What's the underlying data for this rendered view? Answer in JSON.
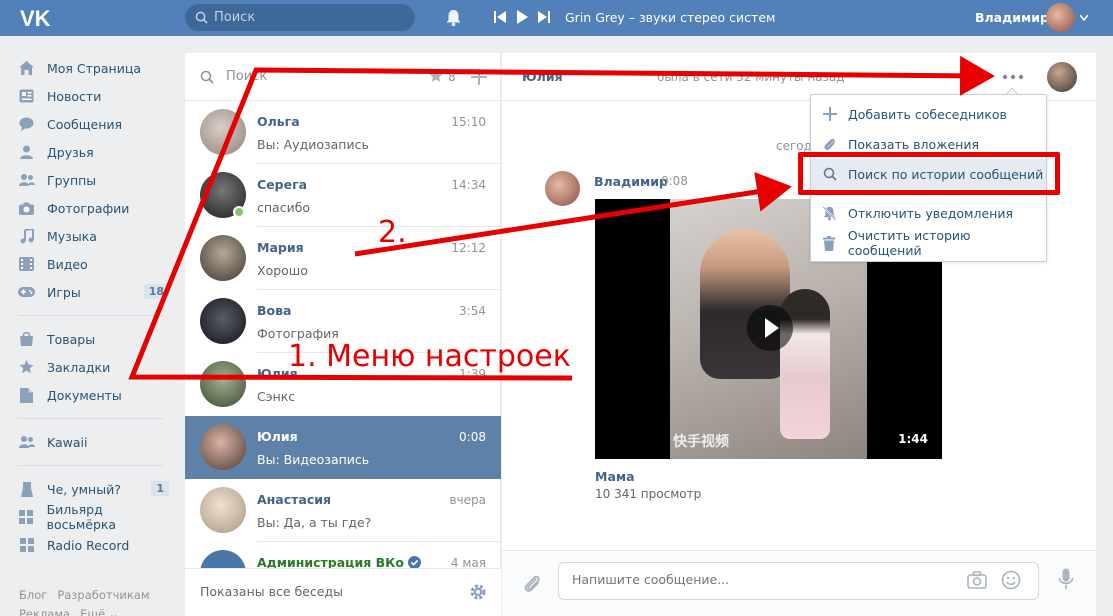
{
  "header": {
    "logo": "VK",
    "search_placeholder": "Поиск",
    "track": "Grin Grey – звуки стерео систем",
    "user_name": "Владимир"
  },
  "menu": {
    "items": [
      {
        "label": "Моя Страница",
        "icon": "home-icon"
      },
      {
        "label": "Новости",
        "icon": "news-icon"
      },
      {
        "label": "Сообщения",
        "icon": "messages-icon"
      },
      {
        "label": "Друзья",
        "icon": "friends-icon"
      },
      {
        "label": "Группы",
        "icon": "groups-icon"
      },
      {
        "label": "Фотографии",
        "icon": "camera-icon"
      },
      {
        "label": "Музыка",
        "icon": "music-icon"
      },
      {
        "label": "Видео",
        "icon": "video-icon"
      },
      {
        "label": "Игры",
        "icon": "games-icon",
        "badge": "18"
      }
    ],
    "items2": [
      {
        "label": "Товары",
        "icon": "goods-icon"
      },
      {
        "label": "Закладки",
        "icon": "star-icon"
      },
      {
        "label": "Документы",
        "icon": "docs-icon"
      }
    ],
    "items3": [
      {
        "label": "Kawaii",
        "icon": "group-icon"
      }
    ],
    "items4": [
      {
        "label": "Че, умный?",
        "icon": "app-icon",
        "badge": "1"
      },
      {
        "label": "Бильярд восьмёрка",
        "icon": "app-icon"
      },
      {
        "label": "Radio Record",
        "icon": "app-icon"
      }
    ],
    "footer": [
      "Блог",
      "Разработчикам",
      "Реклама",
      "Ещё ⌄"
    ]
  },
  "dialogs": {
    "search_placeholder": "Поиск",
    "starred_count": "8",
    "items": [
      {
        "name": "Ольга",
        "time": "15:10",
        "preview": "Вы: Аудиозапись",
        "avatar_color": "#b9a89b"
      },
      {
        "name": "Серега",
        "time": "14:34",
        "preview": "спасибо",
        "avatar_color": "#3b3b3b",
        "online": true
      },
      {
        "name": "Мария",
        "time": "12:12",
        "preview": "Хорошо",
        "avatar_color": "#6d6458"
      },
      {
        "name": "Вова",
        "time": "3:54",
        "preview": "Фотография",
        "avatar_color": "#22252b"
      },
      {
        "name": "Юлия",
        "time": "1:39",
        "preview": "Сэнкс",
        "avatar_color": "#5d7a4f"
      },
      {
        "name": "Юлия",
        "time": "0:08",
        "preview": "Вы: Видеозапись",
        "avatar_color": "#7a5a50",
        "active": true
      },
      {
        "name": "Анастасия",
        "time": "вчера",
        "preview": "Вы: Да, а ты где?",
        "avatar_color": "#d8c6b3"
      },
      {
        "name": "Администрация ВКо",
        "time": "4 мая",
        "preview": "",
        "avatar_color": "#4a76a8",
        "verified": true
      }
    ],
    "footer_text": "Показаны все беседы"
  },
  "chat": {
    "name": "Юлия",
    "status": "была в сети 32 минуты назад",
    "day_label": "сегодня",
    "message": {
      "author": "Владимир",
      "time": "0:08",
      "video_duration": "1:44",
      "video_watermark": "快手视频",
      "video_title": "Мама",
      "video_views": "10 341 просмотр"
    },
    "compose_placeholder": "Напишите сообщение..."
  },
  "dropdown": {
    "items": [
      {
        "label": "Добавить собеседников",
        "icon": "plus-icon"
      },
      {
        "label": "Показать вложения",
        "icon": "paperclip-icon"
      },
      {
        "label": "Поиск по истории сообщений",
        "icon": "search-icon",
        "highlighted": true
      },
      {
        "label": "Отключить уведомления",
        "icon": "mute-icon"
      },
      {
        "label": "Очистить историю сообщений",
        "icon": "trash-icon"
      }
    ]
  },
  "annotations": {
    "step1": "1. Меню настроек",
    "step2": "2.",
    "color": "#e80000"
  }
}
